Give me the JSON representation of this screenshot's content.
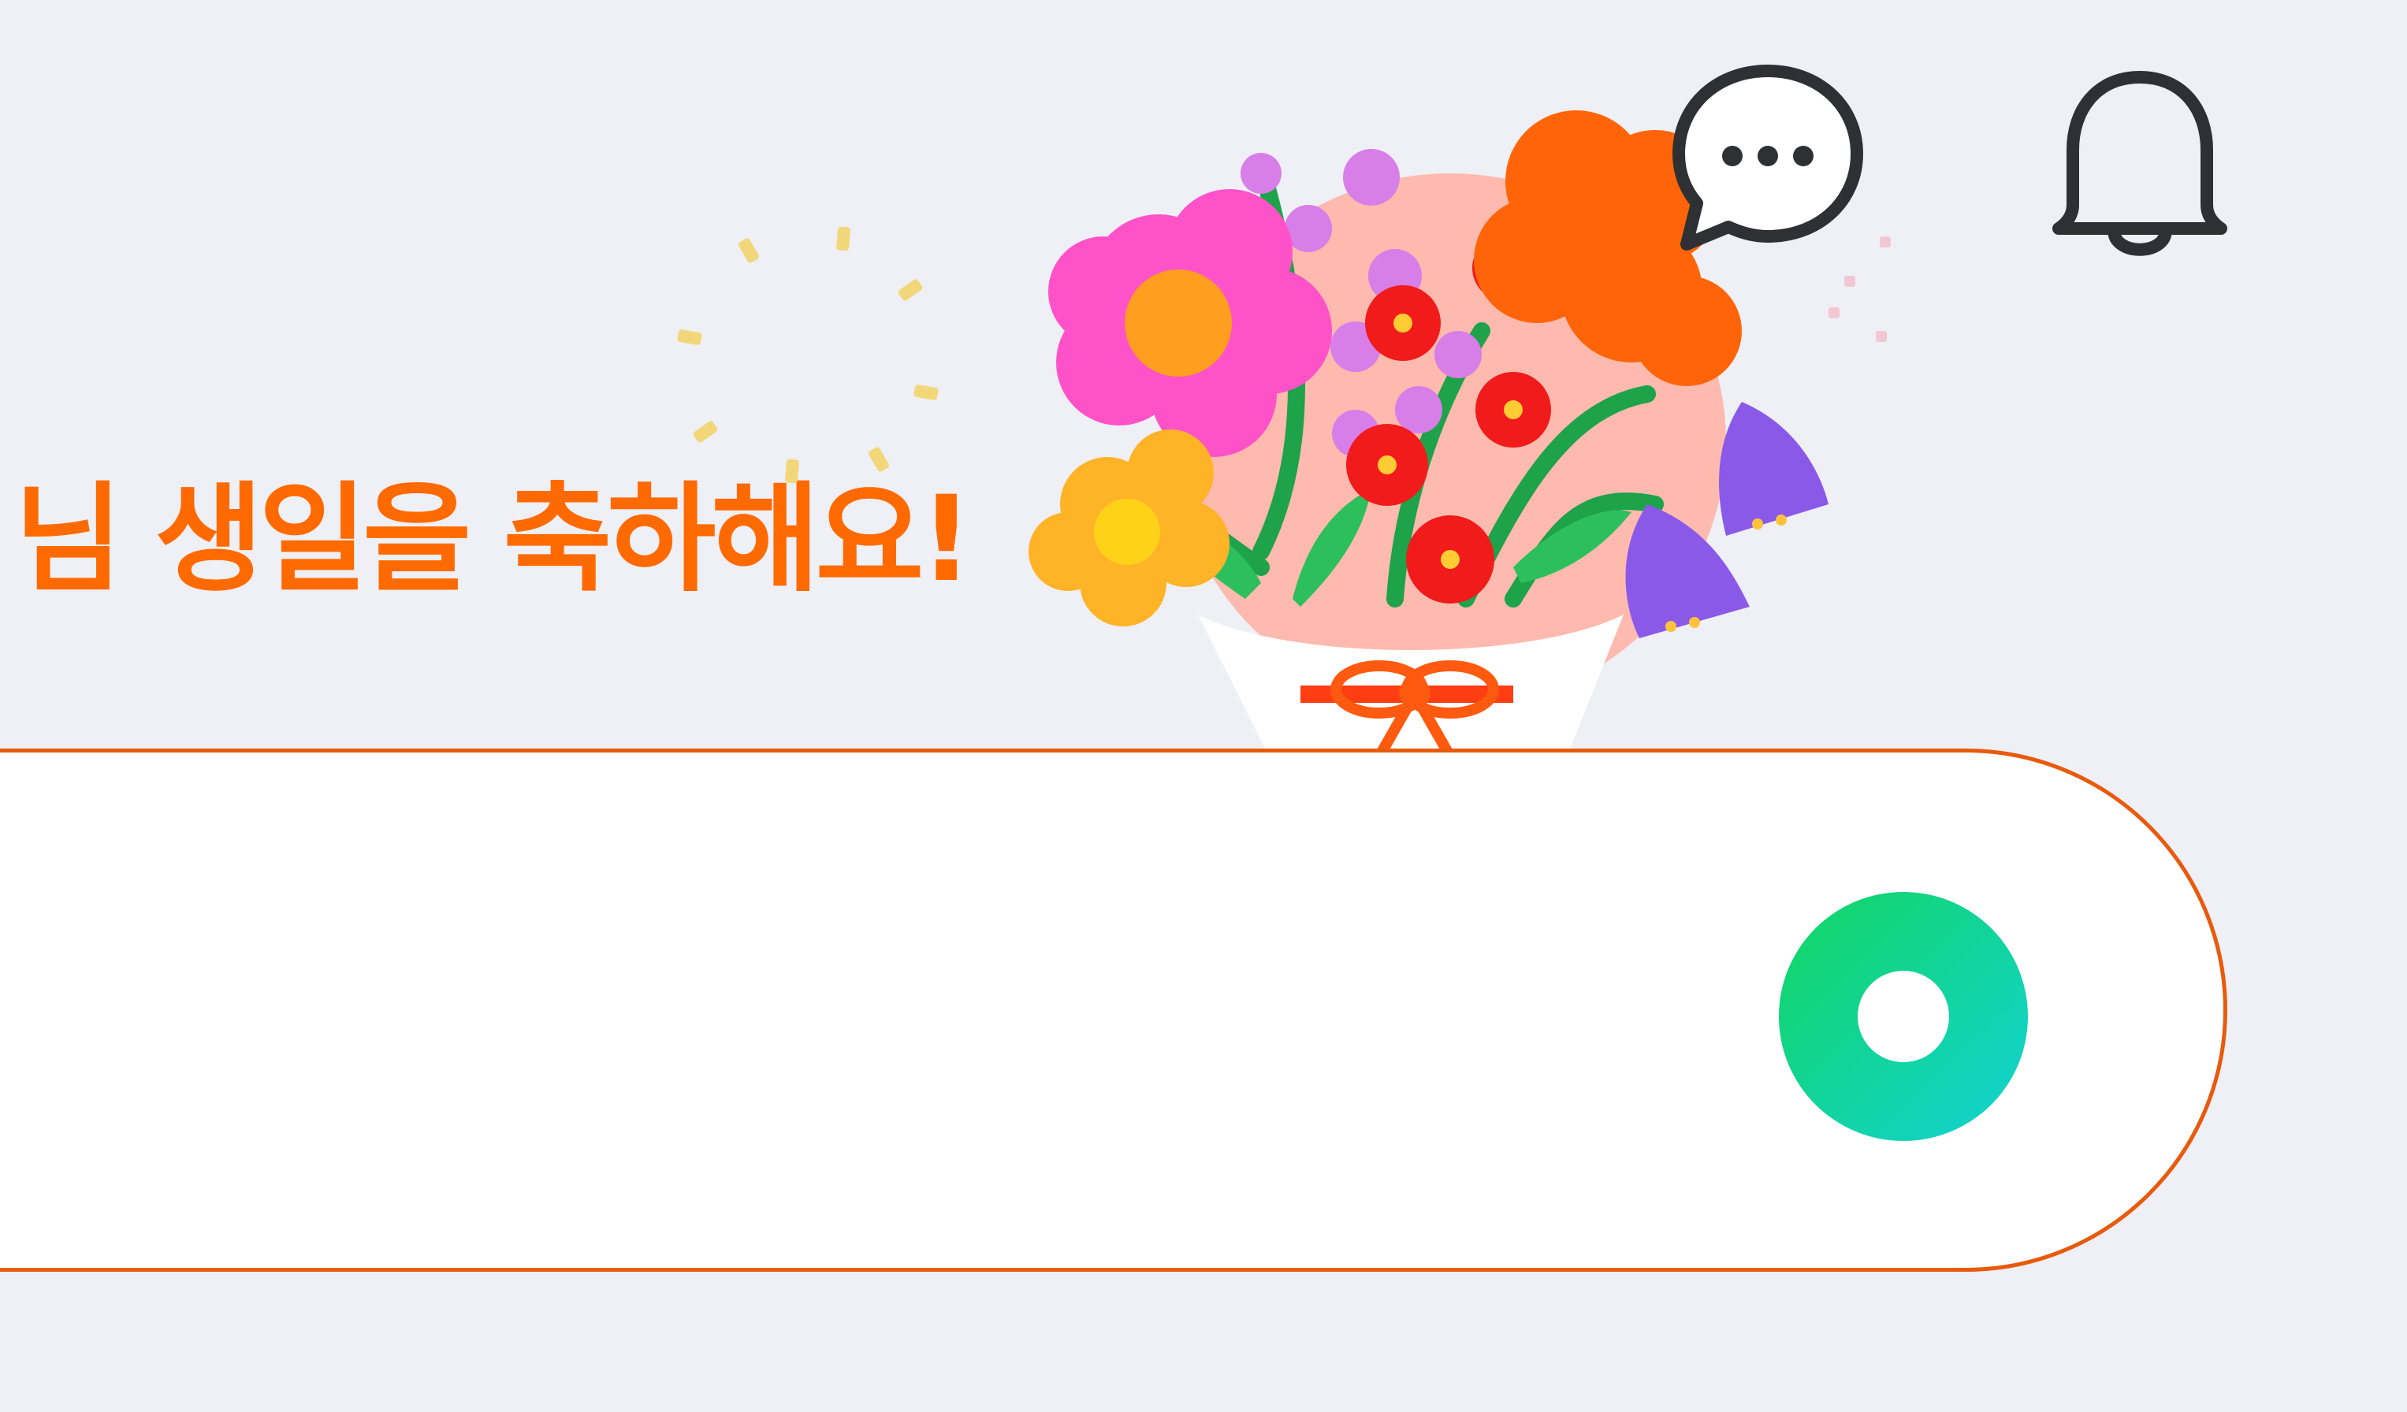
{
  "header": {
    "greeting": "님 생일을 축하해요!"
  },
  "search": {
    "value": "",
    "placeholder": ""
  },
  "icons": {
    "chat": "chat-bubble-more-icon",
    "notifications": "bell-icon",
    "search_action": "green-circle-search-icon",
    "illustration": "flower-bouquet-illustration"
  },
  "colors": {
    "accent": "#ff6a00",
    "search_border": "#e85a0c",
    "background": "#eef0f6",
    "search_button_start": "#12d660",
    "search_button_end": "#12d2d6"
  }
}
